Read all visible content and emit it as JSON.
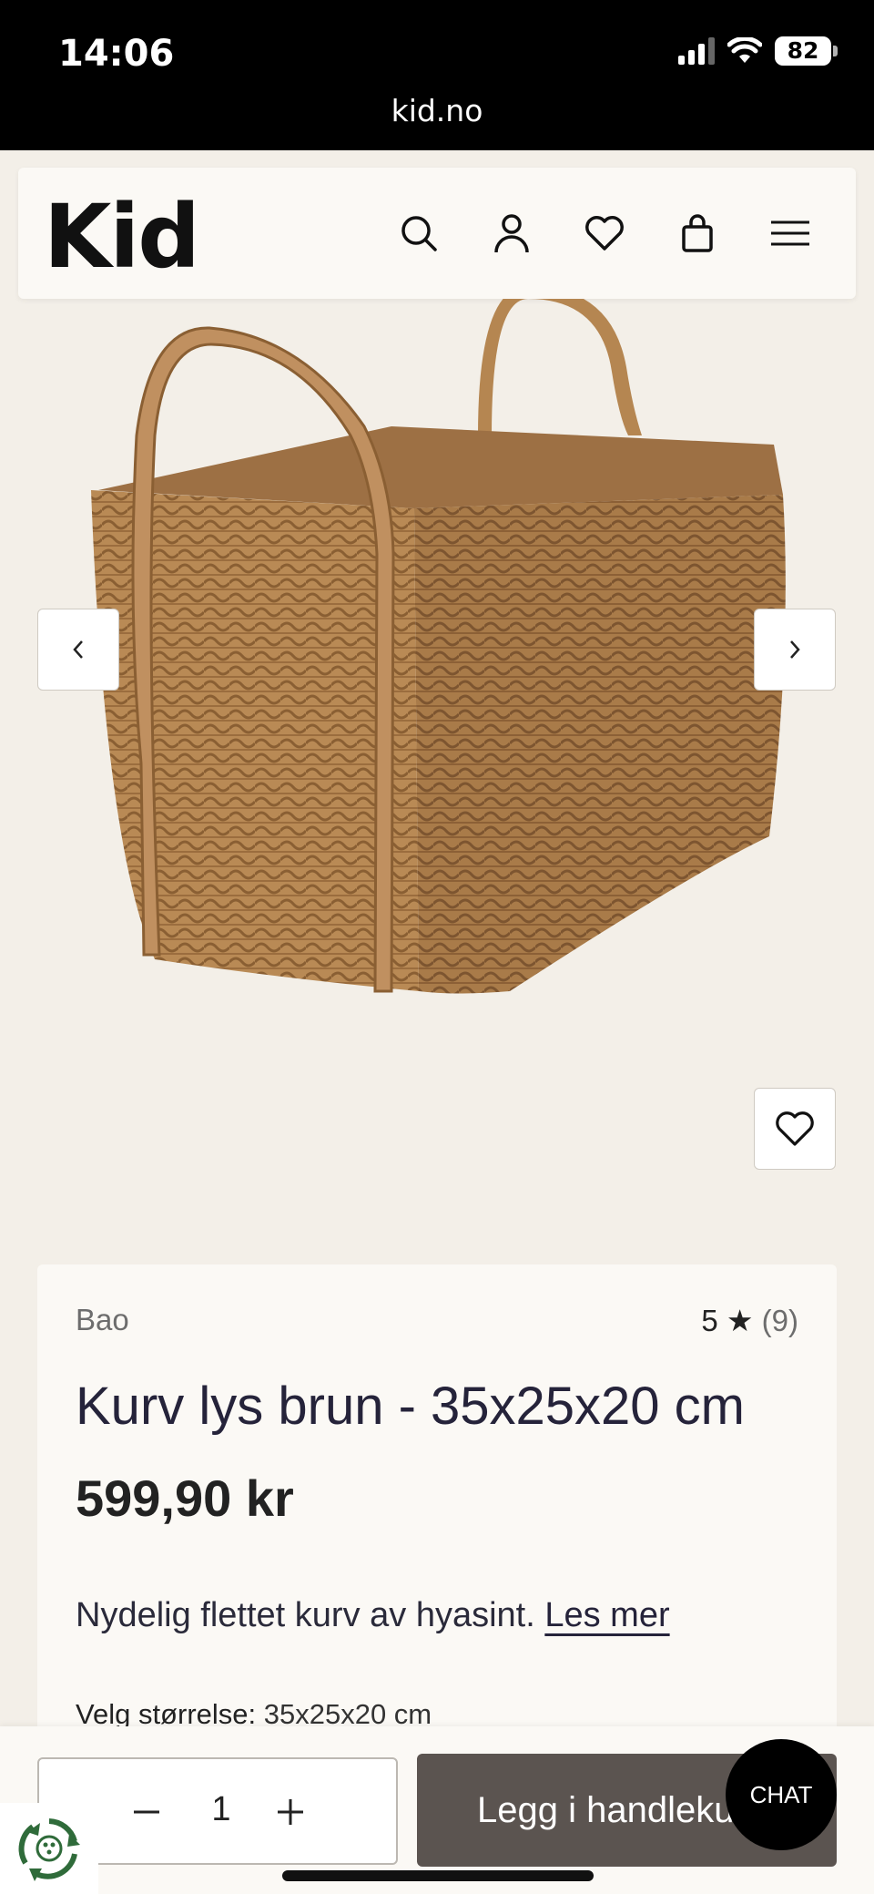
{
  "status": {
    "time": "14:06",
    "url": "kid.no",
    "battery": "82"
  },
  "header": {
    "logo": "Kid",
    "icons": [
      "search-icon",
      "user-icon",
      "heart-icon",
      "bag-icon",
      "menu-icon"
    ]
  },
  "gallery": {
    "image_alt": "woven basket",
    "prev_label": "‹",
    "next_label": "›"
  },
  "product": {
    "brand": "Bao",
    "rating_value": "5",
    "rating_star": "★",
    "rating_count": "(9)",
    "title": "Kurv lys brun - 35x25x20 cm",
    "price": "599,90 kr",
    "description": "Nydelig flettet kurv av hyasint.",
    "read_more": "Les mer",
    "size_label": "Velg størrelse:",
    "size_value": "35x25x20 cm"
  },
  "cart_bar": {
    "quantity": "1",
    "add_label": "Legg i handlekurv",
    "chat_label": "CHAT"
  },
  "colors": {
    "page_bg": "#f3efe8",
    "card_bg": "#fbf9f5",
    "button_bg": "#5b5450",
    "text": "#25233a"
  }
}
